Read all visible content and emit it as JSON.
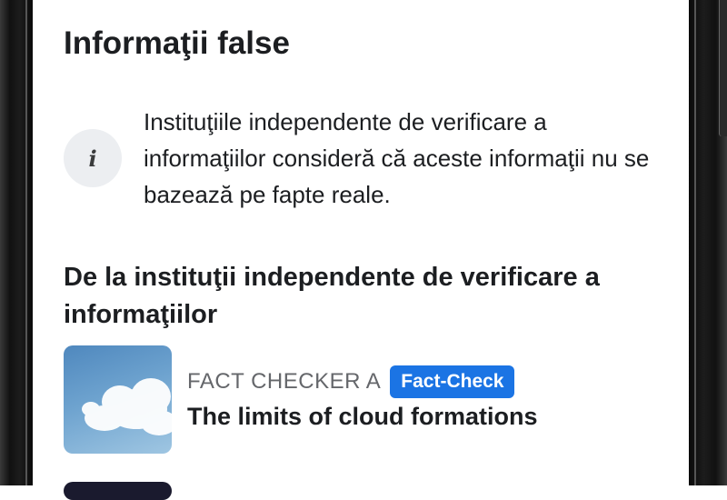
{
  "header": {
    "title": "Informaţii false"
  },
  "notice": {
    "icon": "info-icon",
    "icon_glyph": "i",
    "text": "Instituţiile independente de verificare a informaţiilor consideră că aceste informaţii nu se bazează pe fapte reale."
  },
  "section": {
    "heading": "De la instituţii independente de verificare a informaţiilor"
  },
  "articles": [
    {
      "publisher": "FACT CHECKER A",
      "badge": "Fact-Check",
      "title": "The limits of cloud formations",
      "thumbnail": "cloud-sky-image"
    }
  ],
  "colors": {
    "badge_bg": "#1b74e4",
    "text_primary": "#1c1e21",
    "text_secondary": "#65676b",
    "icon_bg": "#eceef1"
  }
}
